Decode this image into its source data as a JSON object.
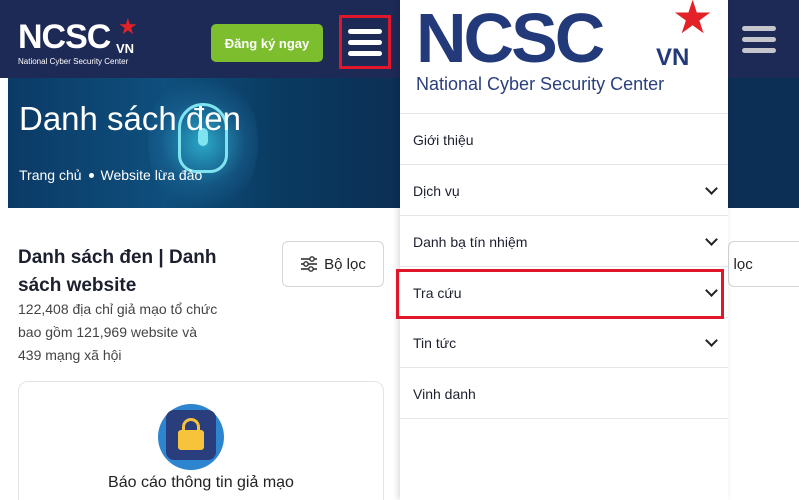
{
  "site": {
    "logo_text": "NCSC",
    "logo_vn": "VN",
    "logo_sub": "National Cyber Security Center",
    "register_label": "Đăng ký ngay",
    "hero_title": "Danh sách đen",
    "breadcrumb": [
      "Trang chủ",
      "Website lừa đảo"
    ],
    "section_title": "Danh sách đen | Danh sách website",
    "description": "122,408 địa chỉ giả mạo tổ chức bao gồm 121,969 website và 439 mạng xã hội",
    "filter_label": "Bộ lọc",
    "card_title": "Báo cáo thông tin giả mạo"
  },
  "drawer": {
    "logo_text": "NCSC",
    "logo_vn": "VN",
    "logo_sub": "National Cyber Security Center",
    "items": [
      {
        "label": "Giới thiệu",
        "chevron": false
      },
      {
        "label": "Dịch vụ",
        "chevron": true
      },
      {
        "label": "Danh bạ tín nhiệm",
        "chevron": true
      },
      {
        "label": "Tra cứu",
        "chevron": true,
        "highlighted": true
      },
      {
        "label": "Tin tức",
        "chevron": true
      },
      {
        "label": "Vinh danh",
        "chevron": false
      }
    ]
  },
  "behind": {
    "filter_partial": "Bộ lọc"
  },
  "colors": {
    "header_bg": "#1e2a56",
    "brand_blue": "#233a7a",
    "accent_red": "#e32228",
    "highlight_red": "#e0172b",
    "register_green": "#7cbe2e"
  },
  "icons": [
    "hamburger-icon",
    "filter-sliders-icon",
    "chevron-down-icon",
    "lock-shield-icon",
    "star-icon"
  ]
}
